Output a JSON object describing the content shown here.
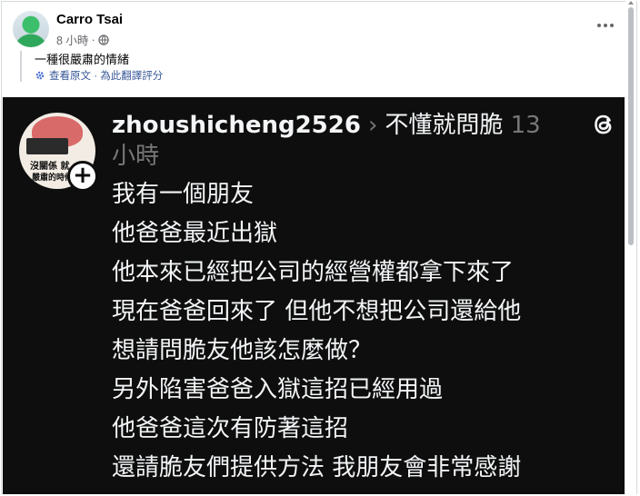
{
  "post": {
    "author": "Carro Tsai",
    "time": "8 小時",
    "separator": "·",
    "caption": "一種很嚴肅的情緒",
    "translate_link": "查看原文 · 為此翻譯評分"
  },
  "threads": {
    "username": "zhoushicheng2526",
    "chevron": "›",
    "community": "不懂就問脆",
    "timestamp": "13 小時",
    "avatar_text_1": "沒關係 就",
    "avatar_text_2": "嚴肅的時候",
    "follow_symbol": "+",
    "body_lines": [
      "我有一個朋友",
      "他爸爸最近出獄",
      "他本來已經把公司的經營權都拿下來了",
      "現在爸爸回來了 但他不想把公司還給他",
      "想請問脆友他該怎麼做？",
      "另外陷害爸爸入獄這招已經用過",
      "他爸爸這次有防著這招",
      "還請脆友們提供方法  我朋友會非常感謝"
    ]
  },
  "colors": {
    "link": "#385898",
    "dark_panel": "#0e0e0e",
    "muted_text": "#777777"
  },
  "icons": [
    "globe-icon",
    "more-icon",
    "gear-icon",
    "add-icon",
    "threads-logo-icon"
  ]
}
